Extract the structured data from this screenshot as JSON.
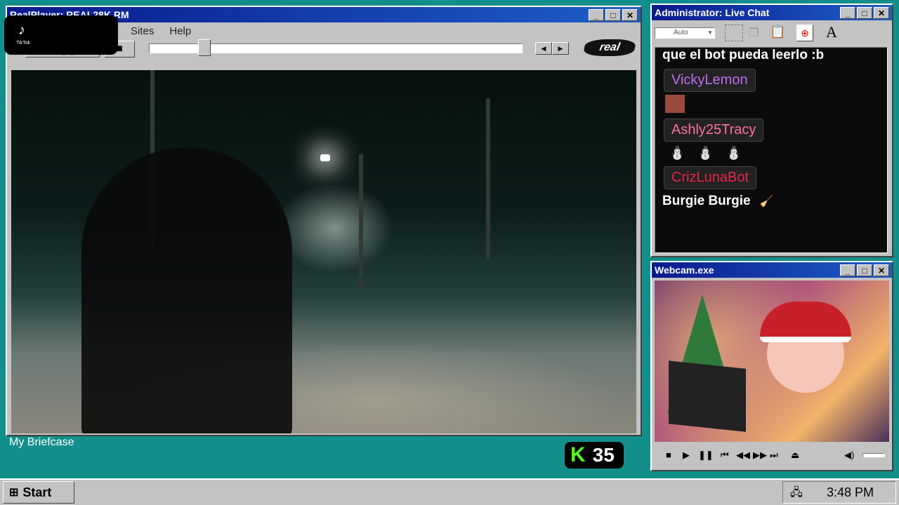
{
  "realplayer": {
    "title": "RealPlayer: REAL28K.RM",
    "menu": [
      "Sites",
      "Help"
    ],
    "logo": "real"
  },
  "tiktok": {
    "label": "TikTok"
  },
  "desktop": {
    "briefcase_label": "My Briefcase"
  },
  "kick_badge": {
    "letter": "K",
    "count": "35",
    "color": "#53fc18"
  },
  "chat": {
    "title": "Administrator: Live Chat",
    "font_select": "Auto",
    "messages": [
      {
        "user": "",
        "text": "que el bot pueda leerlo :b"
      },
      {
        "user": "VickyLemon",
        "user_color": "#c06cf5",
        "text": ""
      },
      {
        "user": "Ashly25Tracy",
        "user_color": "#ff6fa0",
        "text": ""
      },
      {
        "user": "CrizLunaBot",
        "user_color": "#e8254a",
        "text": "Burgie Burgie"
      }
    ]
  },
  "webcam": {
    "title": "Webcam.exe"
  },
  "taskbar": {
    "start": "Start",
    "clock": "3:48 PM"
  },
  "colors": {
    "desktop": "#128f8c",
    "titlebar": "#0a1a8c"
  }
}
